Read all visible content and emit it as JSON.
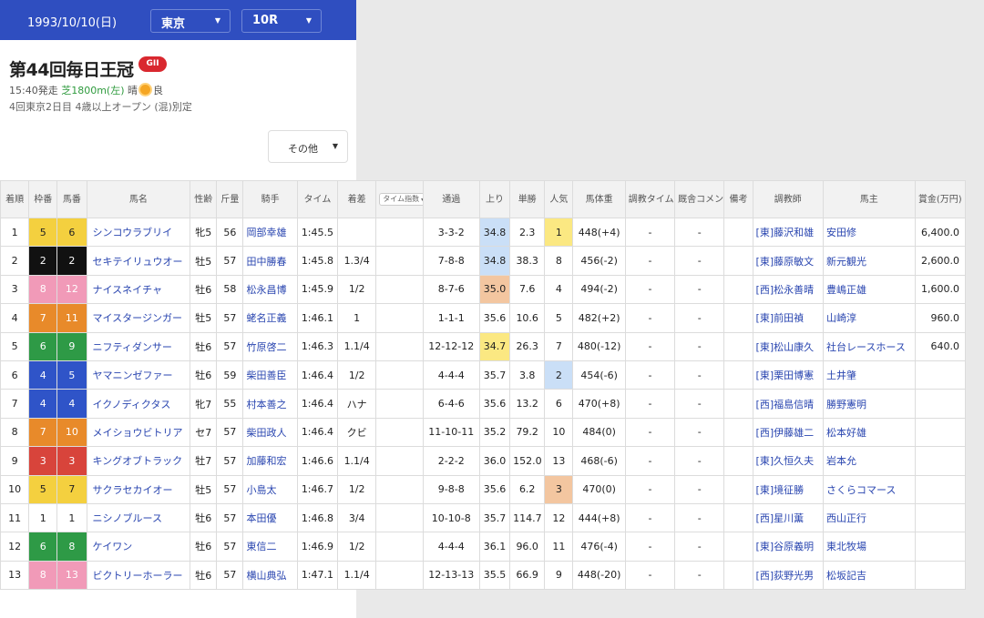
{
  "header": {
    "date": "1993/10/10(日)",
    "venue": "東京",
    "race_no": "10R"
  },
  "race": {
    "name": "第44回毎日王冠",
    "grade": "GII",
    "start_time": "15:40発走",
    "course": "芝1800m(左)",
    "weather": "晴",
    "track_condition": "良",
    "meeting": "4回東京2日目",
    "conditions": "4歳以上オープン (混)別定"
  },
  "controls": {
    "other_label": "その他"
  },
  "colors": {
    "frame_bg": [
      "#ffffff",
      "#111111",
      "#d8443b",
      "#2f54c8",
      "#f4d03f",
      "#2e9a46",
      "#e88a2a",
      "#f19ab8"
    ],
    "frame_fg": [
      "#222222",
      "#ffffff",
      "#ffffff",
      "#ffffff",
      "#222222",
      "#ffffff",
      "#ffffff",
      "#ffffff"
    ],
    "last3f_rank": [
      "#fbe882",
      "#cadff7",
      "#f3c6a0"
    ],
    "popularity_rank": [
      "#fbe882",
      "#cadff7",
      "#f3c6a0"
    ]
  },
  "table": {
    "columns": [
      "着順",
      "枠番",
      "馬番",
      "馬名",
      "性齢",
      "斤量",
      "騎手",
      "タイム",
      "着差",
      "タイム指数",
      "通過",
      "上り",
      "単勝",
      "人気",
      "馬体重",
      "調教タイム",
      "厩舎コメント",
      "備考",
      "調教師",
      "馬主",
      "賞金(万円)"
    ],
    "rows": [
      {
        "rank": "1",
        "frame": "5",
        "num": "6",
        "horse": "シンコウラブリイ",
        "sex_age": "牝5",
        "weight": "56",
        "jockey": "岡部幸雄",
        "time": "1:45.5",
        "margin": "",
        "index": "",
        "passing": "3-3-2",
        "last3f": "34.8",
        "last3f_rank": 2,
        "odds": "2.3",
        "pop": "1",
        "body": "448(+4)",
        "train": "-",
        "comment": "-",
        "note": "",
        "trainer": "[東]藤沢和雄",
        "owner": "安田修",
        "prize": "6,400.0"
      },
      {
        "rank": "2",
        "frame": "2",
        "num": "2",
        "horse": "セキテイリュウオー",
        "sex_age": "牡5",
        "weight": "57",
        "jockey": "田中勝春",
        "time": "1:45.8",
        "margin": "1.3/4",
        "index": "",
        "passing": "7-8-8",
        "last3f": "34.8",
        "last3f_rank": 2,
        "odds": "38.3",
        "pop": "8",
        "body": "456(-2)",
        "train": "-",
        "comment": "-",
        "note": "",
        "trainer": "[東]藤原敏文",
        "owner": "新元観光",
        "prize": "2,600.0"
      },
      {
        "rank": "3",
        "frame": "8",
        "num": "12",
        "horse": "ナイスネイチャ",
        "sex_age": "牡6",
        "weight": "58",
        "jockey": "松永昌博",
        "time": "1:45.9",
        "margin": "1/2",
        "index": "",
        "passing": "8-7-6",
        "last3f": "35.0",
        "last3f_rank": 3,
        "odds": "7.6",
        "pop": "4",
        "body": "494(-2)",
        "train": "-",
        "comment": "-",
        "note": "",
        "trainer": "[西]松永善晴",
        "owner": "豊嶋正雄",
        "prize": "1,600.0"
      },
      {
        "rank": "4",
        "frame": "7",
        "num": "11",
        "horse": "マイスタージンガー",
        "sex_age": "牡5",
        "weight": "57",
        "jockey": "蛯名正義",
        "time": "1:46.1",
        "margin": "1",
        "index": "",
        "passing": "1-1-1",
        "last3f": "35.6",
        "last3f_rank": 0,
        "odds": "10.6",
        "pop": "5",
        "body": "482(+2)",
        "train": "-",
        "comment": "-",
        "note": "",
        "trainer": "[東]前田禎",
        "owner": "山崎淳",
        "prize": "960.0"
      },
      {
        "rank": "5",
        "frame": "6",
        "num": "9",
        "horse": "ニフティダンサー",
        "sex_age": "牡6",
        "weight": "57",
        "jockey": "竹原啓二",
        "time": "1:46.3",
        "margin": "1.1/4",
        "index": "",
        "passing": "12-12-12",
        "last3f": "34.7",
        "last3f_rank": 1,
        "odds": "26.3",
        "pop": "7",
        "body": "480(-12)",
        "train": "-",
        "comment": "-",
        "note": "",
        "trainer": "[東]松山康久",
        "owner": "社台レースホース",
        "prize": "640.0"
      },
      {
        "rank": "6",
        "frame": "4",
        "num": "5",
        "horse": "ヤマニンゼファー",
        "sex_age": "牡6",
        "weight": "59",
        "jockey": "柴田善臣",
        "time": "1:46.4",
        "margin": "1/2",
        "index": "",
        "passing": "4-4-4",
        "last3f": "35.7",
        "last3f_rank": 0,
        "odds": "3.8",
        "pop": "2",
        "body": "454(-6)",
        "train": "-",
        "comment": "-",
        "note": "",
        "trainer": "[東]栗田博憲",
        "owner": "土井肇",
        "prize": ""
      },
      {
        "rank": "7",
        "frame": "4",
        "num": "4",
        "horse": "イクノディクタス",
        "sex_age": "牝7",
        "weight": "55",
        "jockey": "村本善之",
        "time": "1:46.4",
        "margin": "ハナ",
        "index": "",
        "passing": "6-4-6",
        "last3f": "35.6",
        "last3f_rank": 0,
        "odds": "13.2",
        "pop": "6",
        "body": "470(+8)",
        "train": "-",
        "comment": "-",
        "note": "",
        "trainer": "[西]福島信晴",
        "owner": "勝野憲明",
        "prize": ""
      },
      {
        "rank": "8",
        "frame": "7",
        "num": "10",
        "horse": "メイショウビトリア",
        "sex_age": "セ7",
        "weight": "57",
        "jockey": "柴田政人",
        "time": "1:46.4",
        "margin": "クビ",
        "index": "",
        "passing": "11-10-11",
        "last3f": "35.2",
        "last3f_rank": 0,
        "odds": "79.2",
        "pop": "10",
        "body": "484(0)",
        "train": "-",
        "comment": "-",
        "note": "",
        "trainer": "[西]伊藤雄二",
        "owner": "松本好雄",
        "prize": ""
      },
      {
        "rank": "9",
        "frame": "3",
        "num": "3",
        "horse": "キングオブトラック",
        "sex_age": "牡7",
        "weight": "57",
        "jockey": "加藤和宏",
        "time": "1:46.6",
        "margin": "1.1/4",
        "index": "",
        "passing": "2-2-2",
        "last3f": "36.0",
        "last3f_rank": 0,
        "odds": "152.0",
        "pop": "13",
        "body": "468(-6)",
        "train": "-",
        "comment": "-",
        "note": "",
        "trainer": "[東]久恒久夫",
        "owner": "岩本允",
        "prize": ""
      },
      {
        "rank": "10",
        "frame": "5",
        "num": "7",
        "horse": "サクラセカイオー",
        "sex_age": "牡5",
        "weight": "57",
        "jockey": "小島太",
        "time": "1:46.7",
        "margin": "1/2",
        "index": "",
        "passing": "9-8-8",
        "last3f": "35.6",
        "last3f_rank": 0,
        "odds": "6.2",
        "pop": "3",
        "body": "470(0)",
        "train": "-",
        "comment": "-",
        "note": "",
        "trainer": "[東]境征勝",
        "owner": "さくらコマース",
        "prize": ""
      },
      {
        "rank": "11",
        "frame": "1",
        "num": "1",
        "horse": "ニシノブルース",
        "sex_age": "牡6",
        "weight": "57",
        "jockey": "本田優",
        "time": "1:46.8",
        "margin": "3/4",
        "index": "",
        "passing": "10-10-8",
        "last3f": "35.7",
        "last3f_rank": 0,
        "odds": "114.7",
        "pop": "12",
        "body": "444(+8)",
        "train": "-",
        "comment": "-",
        "note": "",
        "trainer": "[西]星川薫",
        "owner": "西山正行",
        "prize": ""
      },
      {
        "rank": "12",
        "frame": "6",
        "num": "8",
        "horse": "ケイワン",
        "sex_age": "牡6",
        "weight": "57",
        "jockey": "東信二",
        "time": "1:46.9",
        "margin": "1/2",
        "index": "",
        "passing": "4-4-4",
        "last3f": "36.1",
        "last3f_rank": 0,
        "odds": "96.0",
        "pop": "11",
        "body": "476(-4)",
        "train": "-",
        "comment": "-",
        "note": "",
        "trainer": "[東]谷原義明",
        "owner": "東北牧場",
        "prize": ""
      },
      {
        "rank": "13",
        "frame": "8",
        "num": "13",
        "horse": "ビクトリーホーラー",
        "sex_age": "牡6",
        "weight": "57",
        "jockey": "横山典弘",
        "time": "1:47.1",
        "margin": "1.1/4",
        "index": "",
        "passing": "12-13-13",
        "last3f": "35.5",
        "last3f_rank": 0,
        "odds": "66.9",
        "pop": "9",
        "body": "448(-20)",
        "train": "-",
        "comment": "-",
        "note": "",
        "trainer": "[西]荻野光男",
        "owner": "松坂記吉",
        "prize": ""
      }
    ]
  }
}
